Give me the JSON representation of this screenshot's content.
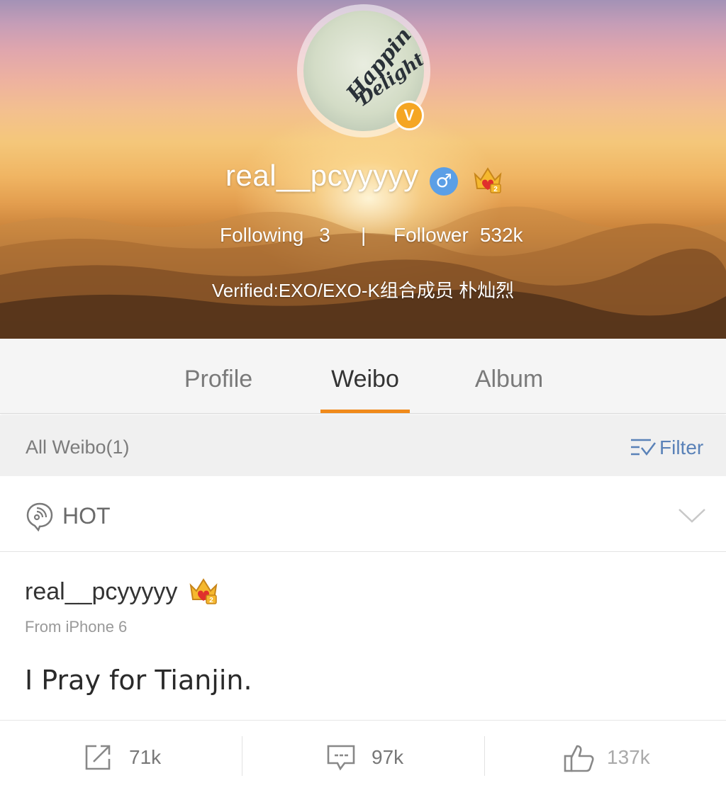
{
  "profile": {
    "username": "real__pcyyyyy",
    "avatar_text_line1": "Happiness",
    "avatar_text_line2": "Delight",
    "verified_badge": "V",
    "gender_symbol": "♂",
    "following_label": "Following",
    "following_count": "3",
    "separator": "|",
    "follower_label": "Follower",
    "follower_count": "532k",
    "verified_description": "Verified:EXO/EXO-K组合成员 朴灿烈"
  },
  "tabs": [
    {
      "label": "Profile",
      "active": false
    },
    {
      "label": "Weibo",
      "active": true
    },
    {
      "label": "Album",
      "active": false
    }
  ],
  "filter_bar": {
    "count_label": "All Weibo(1)",
    "filter_label": "Filter"
  },
  "hot": {
    "label": "HOT"
  },
  "post": {
    "author": "real__pcyyyyy",
    "source": "From iPhone 6",
    "content": "I Pray for Tianjin.",
    "repost_count": "71k",
    "comment_count": "97k",
    "like_count": "137k"
  },
  "colors": {
    "accent": "#f08a1a",
    "link_blue": "#5a82b8",
    "verified_orange": "#f5a623",
    "male_blue": "#5b9fe6"
  },
  "icons": {
    "verified": "verified-v-icon",
    "gender": "male-icon",
    "member": "crown-member-icon",
    "filter": "filter-list-icon",
    "hot": "hot-chat-icon",
    "expand": "chevron-down-icon",
    "repost": "repost-icon",
    "comment": "comment-icon",
    "like": "thumbs-up-icon"
  }
}
